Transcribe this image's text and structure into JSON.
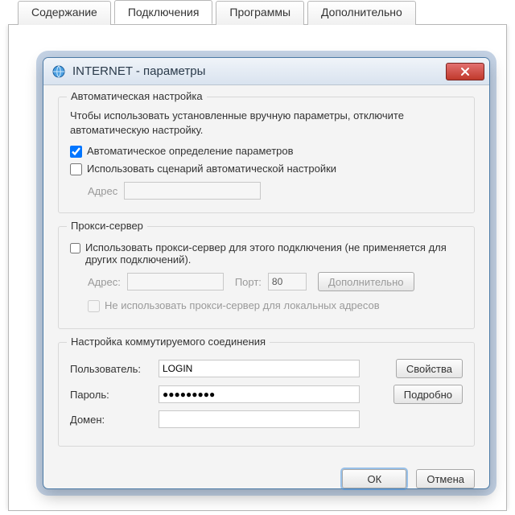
{
  "outer_tabs": [
    {
      "label": "Содержание",
      "active": false
    },
    {
      "label": "Подключения",
      "active": true
    },
    {
      "label": "Программы",
      "active": false
    },
    {
      "label": "Дополнительно",
      "active": false
    }
  ],
  "dialog": {
    "title": "INTERNET - параметры",
    "close": "X",
    "auto": {
      "legend": "Автоматическая настройка",
      "desc": "Чтобы использовать установленные вручную параметры, отключите автоматическую настройку.",
      "chk_detect": "Автоматическое определение параметров",
      "chk_script": "Использовать сценарий автоматической настройки",
      "script_label": "Адрес",
      "script_value": ""
    },
    "proxy": {
      "legend": "Прокси-сервер",
      "chk_use": "Использовать прокси-сервер для этого подключения (не применяется для других подключений).",
      "addr_label": "Адрес:",
      "addr_value": "",
      "port_label": "Порт:",
      "port_value": "80",
      "btn_more": "Дополнительно",
      "chk_bypass": "Не использовать прокси-сервер для локальных адресов"
    },
    "dialup": {
      "legend": "Настройка коммутируемого соединения",
      "user_label": "Пользователь:",
      "user_value": "LOGIN",
      "pw_label": "Пароль:",
      "pw_value": "●●●●●●●●●",
      "domain_label": "Домен:",
      "domain_value": "",
      "btn_props": "Свойства",
      "btn_detail": "Подробно"
    },
    "footer": {
      "ok": "ОК",
      "cancel": "Отмена"
    }
  }
}
